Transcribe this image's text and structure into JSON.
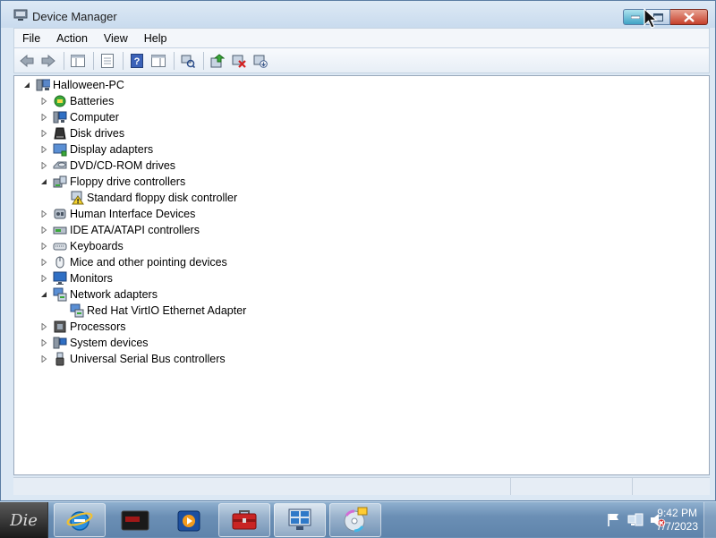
{
  "window": {
    "title": "Device Manager",
    "icon": "device-manager-icon"
  },
  "menu": [
    "File",
    "Action",
    "View",
    "Help"
  ],
  "toolbar": {
    "buttons": [
      "back-arrow-icon",
      "forward-arrow-icon",
      "show-hide-console-tree-icon",
      "properties-icon",
      "help-icon",
      "action-pane-icon",
      "scan-hardware-icon",
      "update-driver-icon",
      "uninstall-icon",
      "disable-icon"
    ]
  },
  "tree": {
    "root": "Halloween-PC",
    "items": [
      {
        "label": "Batteries",
        "icon": "battery-icon",
        "expanded": false,
        "level": 1
      },
      {
        "label": "Computer",
        "icon": "computer-icon",
        "expanded": false,
        "level": 1
      },
      {
        "label": "Disk drives",
        "icon": "disk-drive-icon",
        "expanded": false,
        "level": 1
      },
      {
        "label": "Display adapters",
        "icon": "display-adapter-icon",
        "expanded": false,
        "level": 1
      },
      {
        "label": "DVD/CD-ROM drives",
        "icon": "dvd-drive-icon",
        "expanded": false,
        "level": 1
      },
      {
        "label": "Floppy drive controllers",
        "icon": "floppy-controller-icon",
        "expanded": true,
        "level": 1
      },
      {
        "label": "Standard floppy disk controller",
        "icon": "warning-device-icon",
        "level": 2
      },
      {
        "label": "Human Interface Devices",
        "icon": "hid-icon",
        "expanded": false,
        "level": 1
      },
      {
        "label": "IDE ATA/ATAPI controllers",
        "icon": "ide-controller-icon",
        "expanded": false,
        "level": 1
      },
      {
        "label": "Keyboards",
        "icon": "keyboard-icon",
        "expanded": false,
        "level": 1
      },
      {
        "label": "Mice and other pointing devices",
        "icon": "mouse-icon",
        "expanded": false,
        "level": 1
      },
      {
        "label": "Monitors",
        "icon": "monitor-icon",
        "expanded": false,
        "level": 1
      },
      {
        "label": "Network adapters",
        "icon": "network-adapter-icon",
        "expanded": true,
        "level": 1
      },
      {
        "label": "Red Hat VirtIO Ethernet Adapter",
        "icon": "network-adapter-icon",
        "level": 2
      },
      {
        "label": "Processors",
        "icon": "processor-icon",
        "expanded": false,
        "level": 1
      },
      {
        "label": "System devices",
        "icon": "system-devices-icon",
        "expanded": false,
        "level": 1
      },
      {
        "label": "Universal Serial Bus controllers",
        "icon": "usb-icon",
        "expanded": false,
        "level": 1
      }
    ]
  },
  "taskbar": {
    "start_text": "Die",
    "apps": [
      "internet-explorer-icon",
      "game-app-icon",
      "media-player-icon",
      "toolbox-icon",
      "control-panel-icon",
      "dvd-maker-icon"
    ],
    "tray": [
      "action-center-flag-icon",
      "network-icon",
      "volume-muted-icon"
    ],
    "time": "9:42 PM",
    "date": "7/7/2023"
  }
}
